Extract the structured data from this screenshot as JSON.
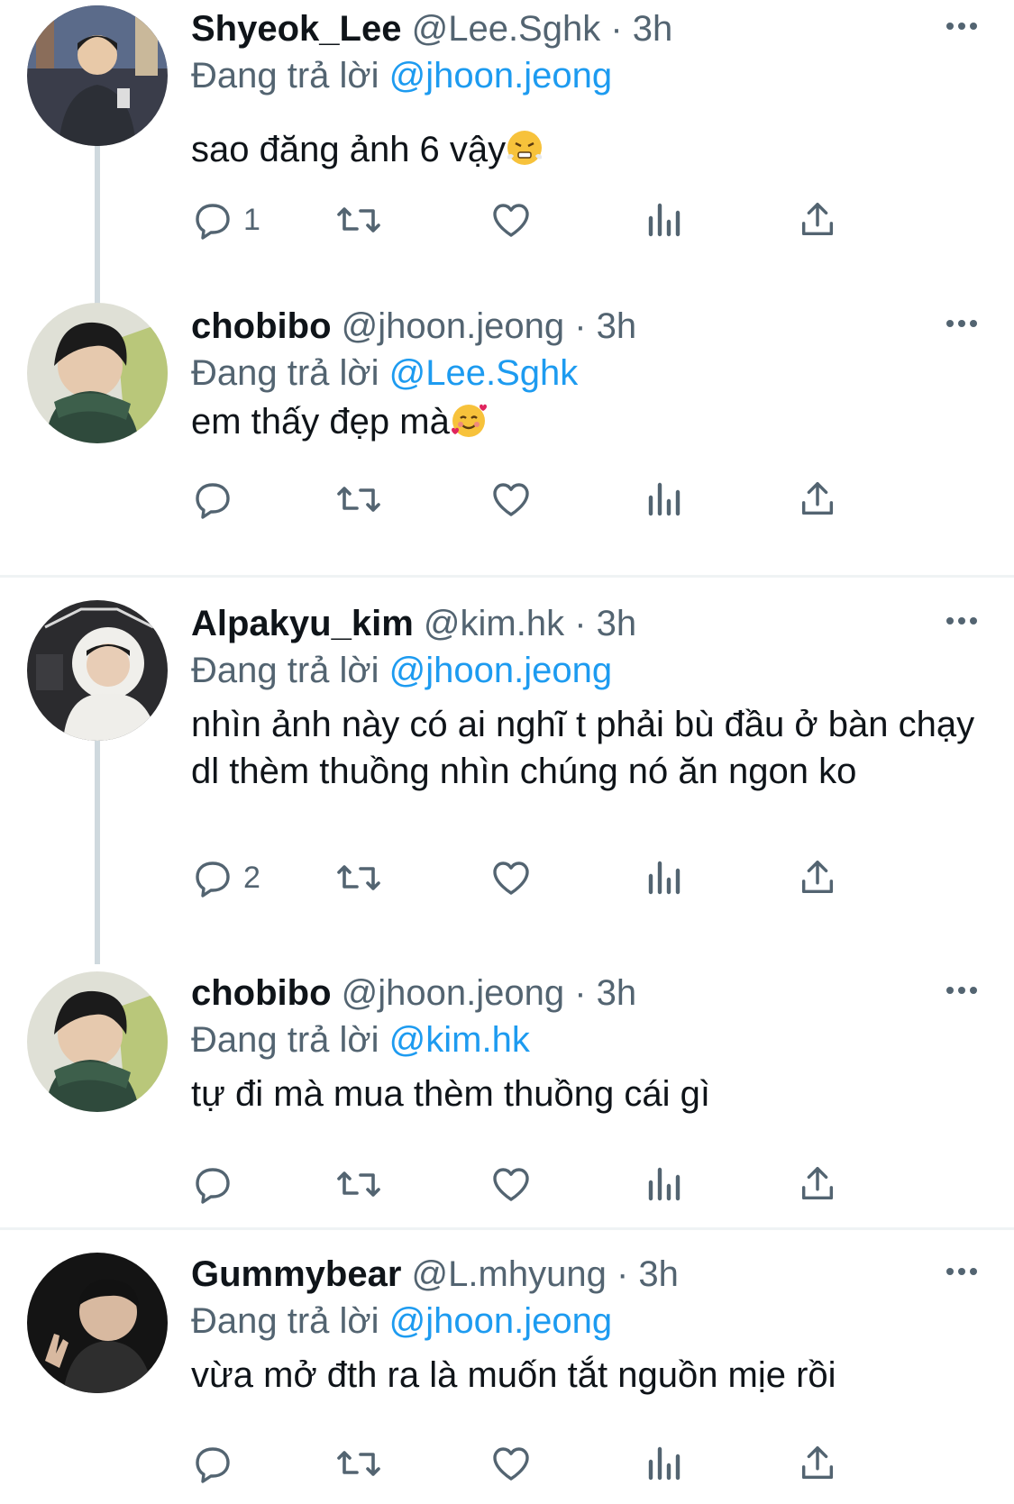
{
  "replying_label": "Đang trả lời",
  "tweets": [
    {
      "name": "Shyeok_Lee",
      "handle": "@Lee.Sghk",
      "time": "3h",
      "reply_to": "@jhoon.jeong",
      "text": "sao đăng ảnh 6 vậy",
      "emoji": "steam-face",
      "reply_count": "1"
    },
    {
      "name": "chobibo",
      "handle": "@jhoon.jeong",
      "time": "3h",
      "reply_to": "@Lee.Sghk",
      "text": "em thấy đẹp mà",
      "emoji": "smiling-hearts-face",
      "reply_count": ""
    },
    {
      "name": "Alpakyu_kim",
      "handle": "@kim.hk",
      "time": "3h",
      "reply_to": "@jhoon.jeong",
      "text": "nhìn ảnh này có ai nghĩ t phải bù đầu ở bàn chạy dl thèm thuồng nhìn chúng nó ăn ngon ko",
      "emoji": "",
      "reply_count": "2"
    },
    {
      "name": "chobibo",
      "handle": "@jhoon.jeong",
      "time": "3h",
      "reply_to": "@kim.hk",
      "text": "tự đi mà mua thèm thuồng cái gì",
      "emoji": "",
      "reply_count": ""
    },
    {
      "name": "Gummybear",
      "handle": "@L.mhyung",
      "time": "3h",
      "reply_to": "@jhoon.jeong",
      "text": "vừa mở đth ra là muốn tắt nguồn mịe rồi",
      "emoji": "",
      "reply_count": ""
    }
  ],
  "colors": {
    "accent": "#1d9bf0",
    "secondary_text": "#536471",
    "thread_line": "#cfd9de",
    "divider": "#eff3f4"
  },
  "icons": [
    "reply-icon",
    "retweet-icon",
    "like-icon",
    "views-icon",
    "share-icon",
    "more-icon"
  ]
}
